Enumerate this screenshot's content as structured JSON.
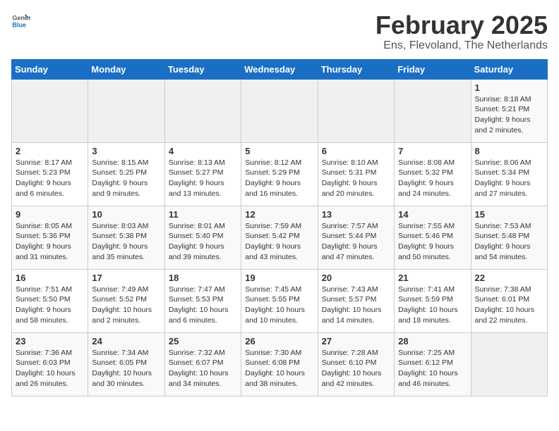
{
  "header": {
    "logo_general": "General",
    "logo_blue": "Blue",
    "title": "February 2025",
    "subtitle": "Ens, Flevoland, The Netherlands"
  },
  "days_of_week": [
    "Sunday",
    "Monday",
    "Tuesday",
    "Wednesday",
    "Thursday",
    "Friday",
    "Saturday"
  ],
  "weeks": [
    [
      {
        "day": "",
        "info": ""
      },
      {
        "day": "",
        "info": ""
      },
      {
        "day": "",
        "info": ""
      },
      {
        "day": "",
        "info": ""
      },
      {
        "day": "",
        "info": ""
      },
      {
        "day": "",
        "info": ""
      },
      {
        "day": "1",
        "info": "Sunrise: 8:18 AM\nSunset: 5:21 PM\nDaylight: 9 hours and 2 minutes."
      }
    ],
    [
      {
        "day": "2",
        "info": "Sunrise: 8:17 AM\nSunset: 5:23 PM\nDaylight: 9 hours and 6 minutes."
      },
      {
        "day": "3",
        "info": "Sunrise: 8:15 AM\nSunset: 5:25 PM\nDaylight: 9 hours and 9 minutes."
      },
      {
        "day": "4",
        "info": "Sunrise: 8:13 AM\nSunset: 5:27 PM\nDaylight: 9 hours and 13 minutes."
      },
      {
        "day": "5",
        "info": "Sunrise: 8:12 AM\nSunset: 5:29 PM\nDaylight: 9 hours and 16 minutes."
      },
      {
        "day": "6",
        "info": "Sunrise: 8:10 AM\nSunset: 5:31 PM\nDaylight: 9 hours and 20 minutes."
      },
      {
        "day": "7",
        "info": "Sunrise: 8:08 AM\nSunset: 5:32 PM\nDaylight: 9 hours and 24 minutes."
      },
      {
        "day": "8",
        "info": "Sunrise: 8:06 AM\nSunset: 5:34 PM\nDaylight: 9 hours and 27 minutes."
      }
    ],
    [
      {
        "day": "9",
        "info": "Sunrise: 8:05 AM\nSunset: 5:36 PM\nDaylight: 9 hours and 31 minutes."
      },
      {
        "day": "10",
        "info": "Sunrise: 8:03 AM\nSunset: 5:38 PM\nDaylight: 9 hours and 35 minutes."
      },
      {
        "day": "11",
        "info": "Sunrise: 8:01 AM\nSunset: 5:40 PM\nDaylight: 9 hours and 39 minutes."
      },
      {
        "day": "12",
        "info": "Sunrise: 7:59 AM\nSunset: 5:42 PM\nDaylight: 9 hours and 43 minutes."
      },
      {
        "day": "13",
        "info": "Sunrise: 7:57 AM\nSunset: 5:44 PM\nDaylight: 9 hours and 47 minutes."
      },
      {
        "day": "14",
        "info": "Sunrise: 7:55 AM\nSunset: 5:46 PM\nDaylight: 9 hours and 50 minutes."
      },
      {
        "day": "15",
        "info": "Sunrise: 7:53 AM\nSunset: 5:48 PM\nDaylight: 9 hours and 54 minutes."
      }
    ],
    [
      {
        "day": "16",
        "info": "Sunrise: 7:51 AM\nSunset: 5:50 PM\nDaylight: 9 hours and 58 minutes."
      },
      {
        "day": "17",
        "info": "Sunrise: 7:49 AM\nSunset: 5:52 PM\nDaylight: 10 hours and 2 minutes."
      },
      {
        "day": "18",
        "info": "Sunrise: 7:47 AM\nSunset: 5:53 PM\nDaylight: 10 hours and 6 minutes."
      },
      {
        "day": "19",
        "info": "Sunrise: 7:45 AM\nSunset: 5:55 PM\nDaylight: 10 hours and 10 minutes."
      },
      {
        "day": "20",
        "info": "Sunrise: 7:43 AM\nSunset: 5:57 PM\nDaylight: 10 hours and 14 minutes."
      },
      {
        "day": "21",
        "info": "Sunrise: 7:41 AM\nSunset: 5:59 PM\nDaylight: 10 hours and 18 minutes."
      },
      {
        "day": "22",
        "info": "Sunrise: 7:38 AM\nSunset: 6:01 PM\nDaylight: 10 hours and 22 minutes."
      }
    ],
    [
      {
        "day": "23",
        "info": "Sunrise: 7:36 AM\nSunset: 6:03 PM\nDaylight: 10 hours and 26 minutes."
      },
      {
        "day": "24",
        "info": "Sunrise: 7:34 AM\nSunset: 6:05 PM\nDaylight: 10 hours and 30 minutes."
      },
      {
        "day": "25",
        "info": "Sunrise: 7:32 AM\nSunset: 6:07 PM\nDaylight: 10 hours and 34 minutes."
      },
      {
        "day": "26",
        "info": "Sunrise: 7:30 AM\nSunset: 6:08 PM\nDaylight: 10 hours and 38 minutes."
      },
      {
        "day": "27",
        "info": "Sunrise: 7:28 AM\nSunset: 6:10 PM\nDaylight: 10 hours and 42 minutes."
      },
      {
        "day": "28",
        "info": "Sunrise: 7:25 AM\nSunset: 6:12 PM\nDaylight: 10 hours and 46 minutes."
      },
      {
        "day": "",
        "info": ""
      }
    ]
  ]
}
